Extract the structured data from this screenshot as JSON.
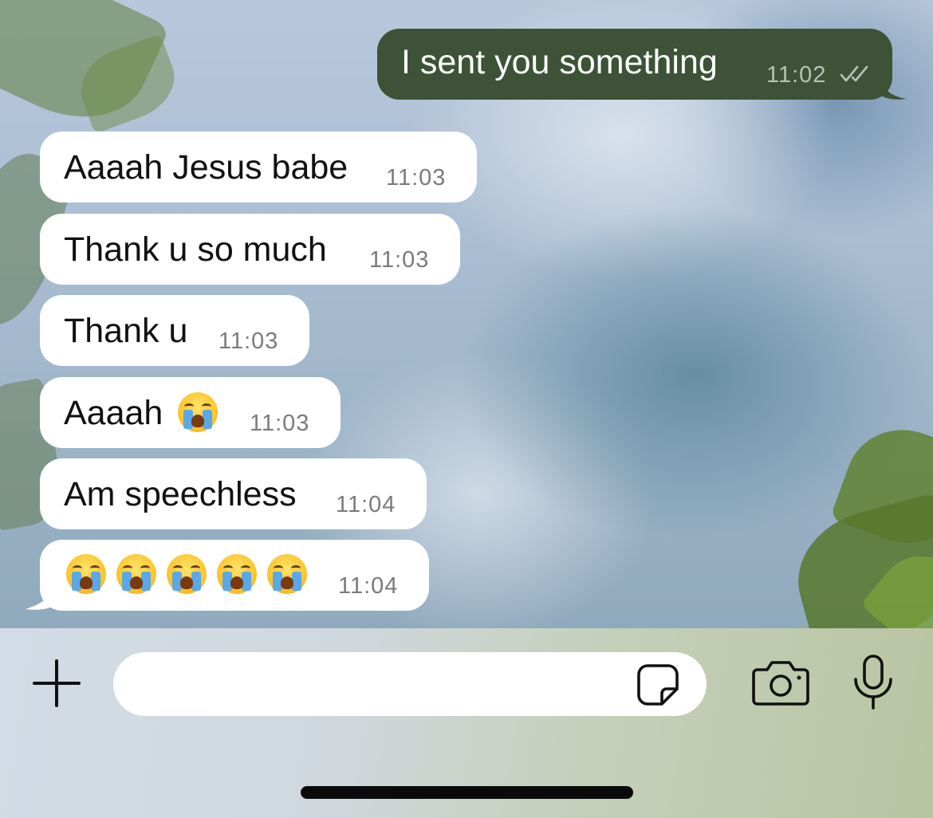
{
  "outgoing": [
    {
      "text": "I sent you something",
      "time": "11:02",
      "status_icon": "double-check-icon"
    }
  ],
  "incoming": [
    {
      "text": "Aaaah Jesus babe",
      "time": "11:03"
    },
    {
      "text": "Thank u so much",
      "time": "11:03"
    },
    {
      "text": "Thank u",
      "time": "11:03"
    },
    {
      "text": "Aaaah",
      "emoji_count": 1,
      "emoji": "loudly-crying-face",
      "time": "11:03"
    },
    {
      "text": "Am speechless",
      "time": "11:04"
    },
    {
      "text": "",
      "emoji_count": 5,
      "emoji": "loudly-crying-face",
      "time": "11:04"
    }
  ],
  "composer": {
    "input_value": "",
    "icons": [
      "plus-icon",
      "sticker-icon",
      "camera-icon",
      "microphone-icon"
    ]
  },
  "colors": {
    "outgoing_bubble": "#3d5237",
    "incoming_bubble": "#ffffff",
    "timestamp": "#7b7b7b"
  }
}
